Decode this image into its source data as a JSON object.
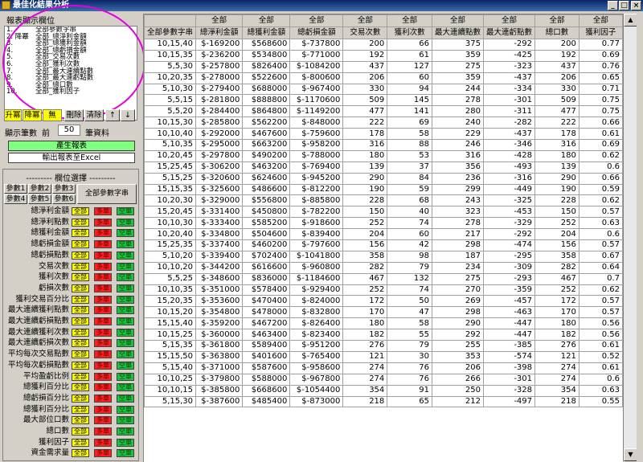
{
  "window": {
    "title": "最佳化結果分析",
    "min": "_",
    "max": "□",
    "close": "×"
  },
  "left": {
    "report_fields_label": "報表顯示欄位",
    "fields": [
      {
        "n": "1.",
        "t": "全部參數字串"
      },
      {
        "n": "2. 降冪",
        "t": "全部_總淨利金額"
      },
      {
        "n": "3.",
        "t": "全部_總獲利金額"
      },
      {
        "n": "4.",
        "t": "全部_總虧損金額"
      },
      {
        "n": "5.",
        "t": "全部_交易次數"
      },
      {
        "n": "6.",
        "t": "全部_獲利次數"
      },
      {
        "n": "7.",
        "t": "全部_最大連續點數"
      },
      {
        "n": "8.",
        "t": "全部_最大連虧點數"
      },
      {
        "n": "9.",
        "t": "全部_總口數"
      },
      {
        "n": "10.",
        "t": "全部_獲利因子"
      }
    ],
    "sort_buttons": [
      "升冪",
      "降冪",
      "無",
      "刪除",
      "清除",
      "↑",
      "↓"
    ],
    "show_count_label": "顯示筆數",
    "front_label": "前",
    "show_count_value": "50",
    "records_label": "筆資料",
    "generate_button": "產生報表",
    "export_button": "輸出報表至Excel",
    "field_select_label": "欄位選擇",
    "param_tabs": [
      "參數1",
      "參數2",
      "參數3",
      "參數4",
      "參數5",
      "參數6"
    ],
    "all_param_button": "全部參數字串",
    "cat_all": "全部",
    "cat_long": "多單",
    "cat_short": "空單",
    "criteria": [
      "總淨利金額",
      "總淨利點數",
      "總獲利金額",
      "總虧損金額",
      "總虧損點數",
      "交易次數",
      "獲利次數",
      "虧損次數",
      "獲利交易百分比",
      "最大連續獲利點數",
      "最大連續虧損點數",
      "最大連續獲利次數",
      "最大連續虧損次數",
      "平均每次交易點數",
      "平均每次虧損點數",
      "平均盈虧比例",
      "總獲利百分比",
      "總虧損百分比",
      "總獲利百分比",
      "最大部位口數",
      "總口數",
      "獲利因子",
      "資金需求量"
    ]
  },
  "grid": {
    "group_header": "全部",
    "columns": [
      "全部參數字串",
      "總淨利金額",
      "總獲利金額",
      "總虧損金額",
      "交易次數",
      "獲利次數",
      "最大連續點數",
      "最大連虧點數",
      "總口數",
      "獲利因子"
    ],
    "rows": [
      [
        "10,15,40",
        "$-169200",
        "$568600",
        "$-737800",
        "200",
        "66",
        "375",
        "-292",
        "200",
        "0.77"
      ],
      [
        "10,15,35",
        "$-236200",
        "$534800",
        "$-771000",
        "192",
        "61",
        "359",
        "-425",
        "192",
        "0.69"
      ],
      [
        "5,5,30",
        "$-257800",
        "$826400",
        "$-1084200",
        "437",
        "127",
        "275",
        "-323",
        "437",
        "0.76"
      ],
      [
        "10,20,35",
        "$-278000",
        "$522600",
        "$-800600",
        "206",
        "60",
        "359",
        "-437",
        "206",
        "0.65"
      ],
      [
        "5,10,30",
        "$-279400",
        "$688000",
        "$-967400",
        "330",
        "94",
        "244",
        "-334",
        "330",
        "0.71"
      ],
      [
        "5,5,15",
        "$-281800",
        "$888800",
        "$-1170600",
        "509",
        "145",
        "278",
        "-301",
        "509",
        "0.75"
      ],
      [
        "5,5,20",
        "$-284400",
        "$864800",
        "$-1149200",
        "477",
        "141",
        "280",
        "-311",
        "477",
        "0.75"
      ],
      [
        "10,15,30",
        "$-285800",
        "$562200",
        "$-848000",
        "222",
        "69",
        "240",
        "-282",
        "222",
        "0.66"
      ],
      [
        "10,10,40",
        "$-292000",
        "$467600",
        "$-759600",
        "178",
        "58",
        "229",
        "-437",
        "178",
        "0.61"
      ],
      [
        "5,10,35",
        "$-295000",
        "$663200",
        "$-958200",
        "316",
        "88",
        "246",
        "-346",
        "316",
        "0.69"
      ],
      [
        "10,20,45",
        "$-297800",
        "$490200",
        "$-788000",
        "180",
        "53",
        "316",
        "-428",
        "180",
        "0.62"
      ],
      [
        "15,25,45",
        "$-306200",
        "$463200",
        "$-769400",
        "139",
        "37",
        "356",
        "-493",
        "139",
        "0.6"
      ],
      [
        "5,15,25",
        "$-320600",
        "$624600",
        "$-945200",
        "290",
        "84",
        "236",
        "-316",
        "290",
        "0.66"
      ],
      [
        "15,15,35",
        "$-325600",
        "$486600",
        "$-812200",
        "190",
        "59",
        "299",
        "-449",
        "190",
        "0.59"
      ],
      [
        "10,20,30",
        "$-329000",
        "$556800",
        "$-885800",
        "228",
        "68",
        "243",
        "-325",
        "228",
        "0.62"
      ],
      [
        "15,20,45",
        "$-331400",
        "$450800",
        "$-782200",
        "150",
        "40",
        "323",
        "-453",
        "150",
        "0.57"
      ],
      [
        "10,10,30",
        "$-333400",
        "$585200",
        "$-918600",
        "252",
        "74",
        "278",
        "-329",
        "252",
        "0.63"
      ],
      [
        "10,20,40",
        "$-334800",
        "$504600",
        "$-839400",
        "204",
        "60",
        "217",
        "-292",
        "204",
        "0.6"
      ],
      [
        "15,25,35",
        "$-337400",
        "$460200",
        "$-797600",
        "156",
        "42",
        "298",
        "-474",
        "156",
        "0.57"
      ],
      [
        "5,10,20",
        "$-339400",
        "$702400",
        "$-1041800",
        "358",
        "98",
        "187",
        "-295",
        "358",
        "0.67"
      ],
      [
        "10,10,20",
        "$-344200",
        "$616600",
        "$-960800",
        "282",
        "79",
        "234",
        "-309",
        "282",
        "0.64"
      ],
      [
        "5,5,25",
        "$-348600",
        "$836000",
        "$-1184600",
        "467",
        "132",
        "275",
        "-293",
        "467",
        "0.7"
      ],
      [
        "10,10,35",
        "$-351000",
        "$578400",
        "$-929400",
        "252",
        "74",
        "270",
        "-359",
        "252",
        "0.62"
      ],
      [
        "15,20,35",
        "$-353600",
        "$470400",
        "$-824000",
        "172",
        "50",
        "269",
        "-457",
        "172",
        "0.57"
      ],
      [
        "10,15,20",
        "$-354800",
        "$478000",
        "$-832800",
        "170",
        "47",
        "298",
        "-463",
        "170",
        "0.57"
      ],
      [
        "15,15,40",
        "$-359200",
        "$467200",
        "$-826400",
        "180",
        "58",
        "290",
        "-447",
        "180",
        "0.56"
      ],
      [
        "10,15,25",
        "$-360000",
        "$463400",
        "$-823400",
        "182",
        "55",
        "292",
        "-447",
        "182",
        "0.56"
      ],
      [
        "5,15,35",
        "$-361800",
        "$589400",
        "$-951200",
        "276",
        "79",
        "255",
        "-385",
        "276",
        "0.61"
      ],
      [
        "15,15,50",
        "$-363800",
        "$401600",
        "$-765400",
        "121",
        "30",
        "353",
        "-574",
        "121",
        "0.52"
      ],
      [
        "5,15,40",
        "$-371000",
        "$587600",
        "$-958600",
        "274",
        "76",
        "206",
        "-398",
        "274",
        "0.61"
      ],
      [
        "10,10,25",
        "$-379800",
        "$588000",
        "$-967800",
        "274",
        "76",
        "266",
        "-301",
        "274",
        "0.6"
      ],
      [
        "10,10,15",
        "$-385800",
        "$668600",
        "$-1054400",
        "354",
        "91",
        "250",
        "-328",
        "354",
        "0.63"
      ],
      [
        "5,15,30",
        "$-387600",
        "$485400",
        "$-873000",
        "218",
        "65",
        "212",
        "-497",
        "218",
        "0.55"
      ]
    ]
  }
}
